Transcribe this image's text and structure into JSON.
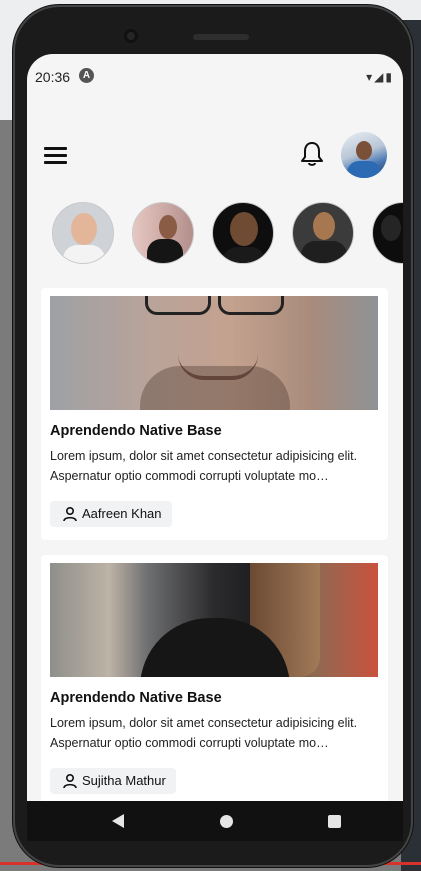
{
  "status_bar": {
    "time": "20:36",
    "app_badge": "A",
    "icons": "▾◢▮"
  },
  "header": {
    "menu_icon": "hamburger-icon",
    "bell_icon": "bell-icon",
    "avatar": "user-avatar"
  },
  "stories": [
    {
      "name": "story-1",
      "bg": "#c9ccd0",
      "face": "#e2b597",
      "body": "#f2f2f2"
    },
    {
      "name": "story-2",
      "bg": "#d8b3b0",
      "face": "#8a5a44",
      "body": "#1a1a1a"
    },
    {
      "name": "story-3",
      "bg": "#111111",
      "face": "#6e4a33",
      "body": "#1a1a1a"
    },
    {
      "name": "story-4",
      "bg": "#3a3a3a",
      "face": "#a7764f",
      "body": "#222222"
    },
    {
      "name": "story-5",
      "bg": "#0f0f0f",
      "face": "#2a2a2a",
      "body": "#0f0f0f"
    }
  ],
  "cards": [
    {
      "title": "Aprendendo Native Base",
      "text": "Lorem ipsum, dolor sit amet consectetur adipisicing elit. Aspernatur optio commodi corrupti voluptate mo…",
      "author": "Aafreen Khan"
    },
    {
      "title": "Aprendendo Native Base",
      "text": "Lorem ipsum, dolor sit amet consectetur adipisicing elit. Aspernatur optio commodi corrupti voluptate mo…",
      "author": "Sujitha Mathur"
    }
  ],
  "nav": {
    "back": "back-icon",
    "home": "home-icon",
    "recents": "recents-icon"
  }
}
